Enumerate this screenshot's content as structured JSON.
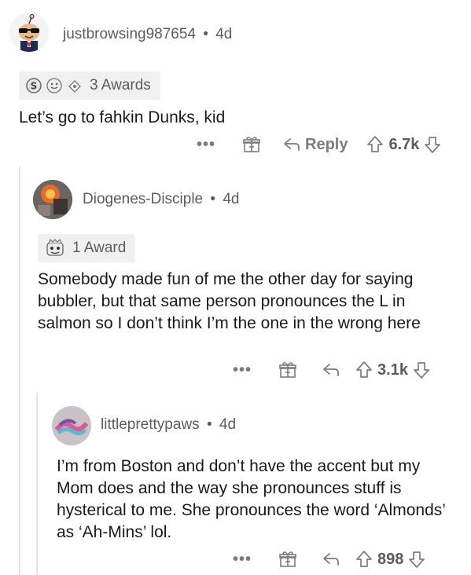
{
  "comments": [
    {
      "username": "justbrowsing987654",
      "age": "4d",
      "awards_label": "3 Awards",
      "text": "Let’s go to fahkin Dunks, kid",
      "more": "•••",
      "reply_label": "Reply",
      "score": "6.7k"
    },
    {
      "username": "Diogenes-Disciple",
      "age": "4d",
      "awards_label": "1 Award",
      "text": "Somebody made fun of me the other day for saying bubbler, but that same person pronounces the L in salmon so I don’t think I’m the one in the wrong here",
      "more": "•••",
      "score": "3.1k"
    },
    {
      "username": "littleprettypaws",
      "age": "4d",
      "text": "I’m from Boston and don’t have the accent but my Mom does and the way she pronounces stuff is hysterical to me. She pronounces the word ‘Almonds’ as ‘Ah-Mins’ lol.",
      "more": "•••",
      "score": "898"
    }
  ],
  "separator": "•",
  "colors": {
    "meta": "#5c5c5c",
    "action": "#7c7c7c",
    "thread_line": "#e3e3e3",
    "award_bg": "#f0f0f0"
  },
  "icons": [
    "snoo-avatar",
    "silver-award-icon",
    "helpful-award-icon",
    "wholesome-award-icon",
    "gift-icon",
    "reply-icon",
    "upvote-icon",
    "downvote-icon"
  ]
}
